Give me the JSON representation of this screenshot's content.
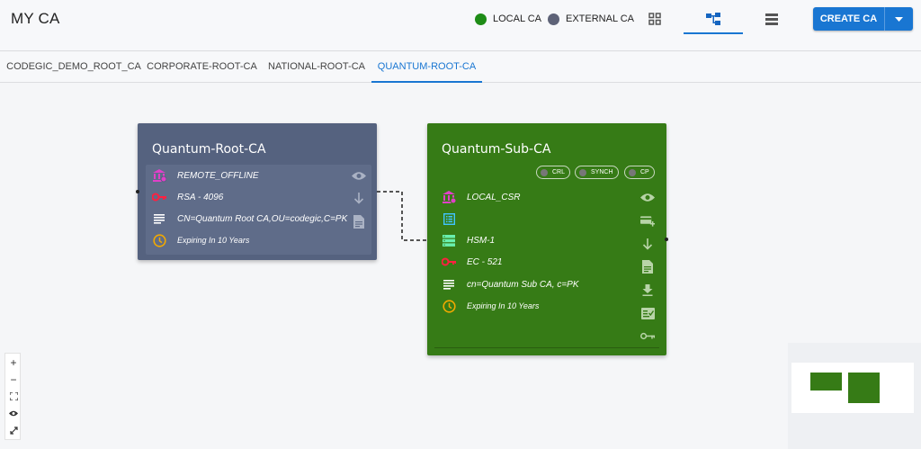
{
  "header": {
    "title": "MY CA",
    "legend": [
      {
        "label": "LOCAL CA",
        "color": "#1e8c16"
      },
      {
        "label": "EXTERNAL CA",
        "color": "#5e6378"
      }
    ],
    "view_icons": [
      "grid-view-icon",
      "tree-view-icon",
      "list-view-icon"
    ],
    "active_view": "tree-view-icon",
    "create_button": "CREATE CA"
  },
  "tabs": [
    {
      "label": "CODEGIC_DEMO_ROOT_CA"
    },
    {
      "label": "CORPORATE-ROOT-CA"
    },
    {
      "label": "NATIONAL-ROOT-CA"
    },
    {
      "label": "QUANTUM-ROOT-CA"
    }
  ],
  "active_tab": "QUANTUM-ROOT-CA",
  "nodes": {
    "root": {
      "title": "Quantum-Root-CA",
      "color": "#55627f",
      "rows": [
        {
          "icon": "bank-icon",
          "text": "REMOTE_OFFLINE"
        },
        {
          "icon": "key-icon",
          "text": "RSA - 4096"
        },
        {
          "icon": "subject-icon",
          "text": "CN=Quantum Root CA,OU=codegic,C=PK"
        },
        {
          "icon": "clock-icon",
          "text": "Expiring In 10 Years"
        }
      ],
      "actions": [
        "view-icon",
        "download-arrow-icon",
        "document-icon"
      ]
    },
    "sub": {
      "title": "Quantum-Sub-CA",
      "color": "#367b16",
      "badges": [
        "CRL",
        "SYNCH",
        "CP"
      ],
      "rows": [
        {
          "icon": "bank-icon",
          "text": "LOCAL_CSR"
        },
        {
          "icon": "list-box-icon",
          "text": ""
        },
        {
          "icon": "hsm-icon",
          "text": "HSM-1"
        },
        {
          "icon": "key-icon",
          "text": "EC - 521"
        },
        {
          "icon": "subject-icon",
          "text": "cn=Quantum Sub CA, c=PK"
        },
        {
          "icon": "clock-icon",
          "text": "Expiring In 10 Years"
        }
      ],
      "actions": [
        "view-icon",
        "add-card-icon",
        "download-arrow-icon",
        "document-icon",
        "download-icon",
        "certificate-icon",
        "key-outline-icon"
      ]
    }
  },
  "zoom_controls": [
    "+",
    "−",
    "fit-view-icon",
    "toggle-view-icon",
    "expand-icon"
  ]
}
